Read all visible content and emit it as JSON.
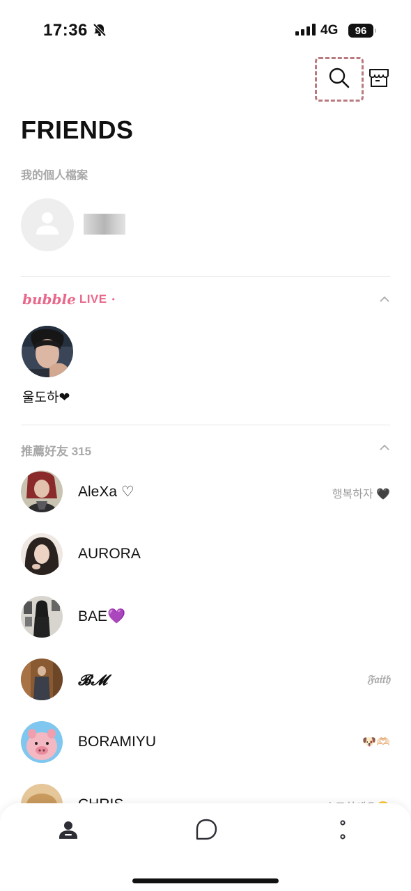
{
  "status_bar": {
    "time": "17:36",
    "network": "4G",
    "battery": "96"
  },
  "header": {
    "title": "FRIENDS"
  },
  "profile": {
    "label": "我的個人檔案"
  },
  "bubble_live": {
    "brand": "bubble",
    "live_label": "LIVE",
    "dot": "•",
    "items": [
      {
        "name": "울도하❤"
      }
    ]
  },
  "recommended": {
    "label": "推薦好友 315",
    "friends": [
      {
        "name": "AleXa ♡",
        "status": "행복하자 🖤"
      },
      {
        "name": "AURORA",
        "status": ""
      },
      {
        "name": "BAE💜",
        "status": ""
      },
      {
        "name": "𝓑𝓜",
        "status": "𝔉𝔞𝔦𝔱𝔥"
      },
      {
        "name": "BORAMIYU",
        "status": "🐶🫶🏻"
      },
      {
        "name": "CHRIS",
        "status": "수고하세요😊"
      }
    ]
  },
  "icons": {
    "search": "search-icon",
    "shop": "shop-icon",
    "friends_tab": "person-icon",
    "chats_tab": "chat-bubble-icon",
    "more_tab": "more-dots-icon"
  },
  "colors": {
    "accent": "#e8688b",
    "search_highlight": "#b97a7f"
  }
}
